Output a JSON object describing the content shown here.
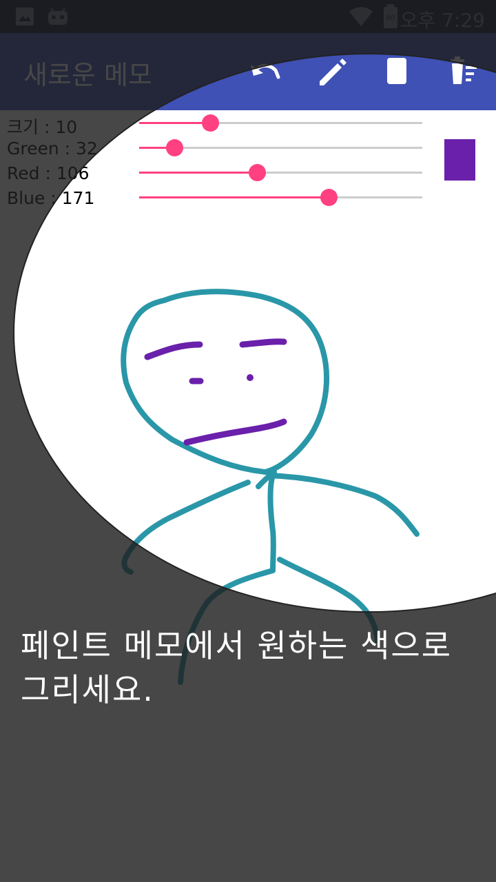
{
  "status_bar": {
    "time": "오후 7:29",
    "battery_level": "80",
    "icons": [
      "image-notification-icon",
      "android-debug-icon",
      "wifi-icon",
      "battery-icon"
    ]
  },
  "toolbar": {
    "title": "새로운 메모",
    "actions": [
      "undo-icon",
      "pen-icon",
      "eraser-icon",
      "clear-icon"
    ]
  },
  "controls": {
    "size_label": "크기 : 10",
    "green_label": "Green : 32",
    "red_label": "Red : 106",
    "blue_label": "Blue : 171",
    "size_fraction": 0.25,
    "green_fraction": 0.125,
    "red_fraction": 0.415,
    "blue_fraction": 0.67,
    "preview_color": "#6a20ab"
  },
  "colors": {
    "accent": "#ff4081",
    "primary": "#3f51b5",
    "stroke_teal": "#2a97a8",
    "stroke_purple": "#6a20ab"
  },
  "showcase": {
    "text": "페인트 메모에서 원하는 색으로 그리세요."
  }
}
